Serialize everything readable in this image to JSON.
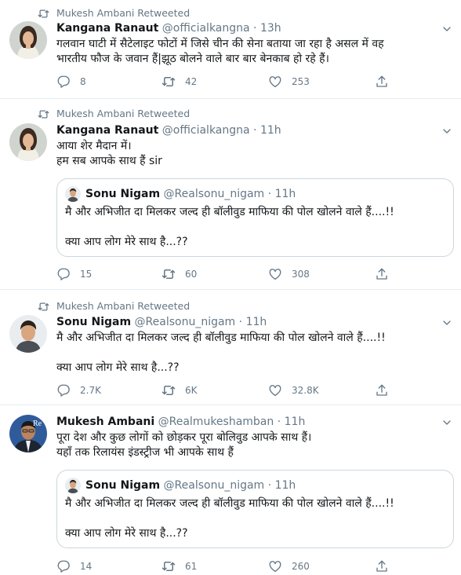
{
  "tweets": [
    {
      "retweeted_by": "Mukesh Ambani Retweeted",
      "name": "Kangana Ranaut",
      "handle": "@officialkangna",
      "dot": "·",
      "time": "13h",
      "text": "गलवान घाटी में सैटेलाइट फोटों में जिसे चीन की सेना बताया जा रहा है असल में वह\nभारतीय फौज के जवान हैं|झूठ बोलने वाले बार बार बेनकाब हो रहे हैं।",
      "replies": "8",
      "retweets": "42",
      "likes": "253"
    },
    {
      "retweeted_by": "Mukesh Ambani Retweeted",
      "name": "Kangana Ranaut",
      "handle": "@officialkangna",
      "dot": "·",
      "time": "11h",
      "text": "आया शेर मैदान में।\nहम सब आपके साथ हैं sir",
      "quote": {
        "name": "Sonu Nigam",
        "handle": "@Realsonu_nigam",
        "dot": "·",
        "time": "11h",
        "text": "मै और अभिजीत दा मिलकर जल्द ही बॉलीवुड माफिया की पोल खोलने वाले हैं....!!\n\nक्या आप लोग मेरे साथ है...??"
      },
      "replies": "15",
      "retweets": "60",
      "likes": "308"
    },
    {
      "retweeted_by": "Mukesh Ambani Retweeted",
      "name": "Sonu Nigam",
      "handle": "@Realsonu_nigam",
      "dot": "·",
      "time": "11h",
      "text": "मै और अभिजीत दा मिलकर जल्द ही बॉलीवुड माफिया की पोल खोलने वाले हैं....!!\n\nक्या आप लोग मेरे साथ है...??",
      "replies": "2.7K",
      "retweets": "6K",
      "likes": "32.8K"
    },
    {
      "name": "Mukesh Ambani",
      "handle": "@Realmukeshamban",
      "dot": "·",
      "time": "11h",
      "avatar_badge": "Re",
      "text": "पूरा देश और कुछ लोगों को छोड़कर पूरा बोलिवुड आपके साथ हैं।\nयहाँ तक रिलायंस इंडस्ट्रीज भी आपके साथ हैं",
      "quote": {
        "name": "Sonu Nigam",
        "handle": "@Realsonu_nigam",
        "dot": "·",
        "time": "11h",
        "text": "मै और अभिजीत दा मिलकर जल्द ही बॉलीवुड माफिया की पोल खोलने वाले हैं....!!\n\nक्या आप लोग मेरे साथ है...??"
      },
      "replies": "14",
      "retweets": "61",
      "likes": "260"
    }
  ],
  "colors": {
    "secondary": "#657786",
    "border": "#e6ecf0",
    "quote_border": "#ccd6dd"
  },
  "icons": [
    "retweet-icon",
    "reply-icon",
    "like-icon",
    "share-icon",
    "caret-down-icon"
  ]
}
